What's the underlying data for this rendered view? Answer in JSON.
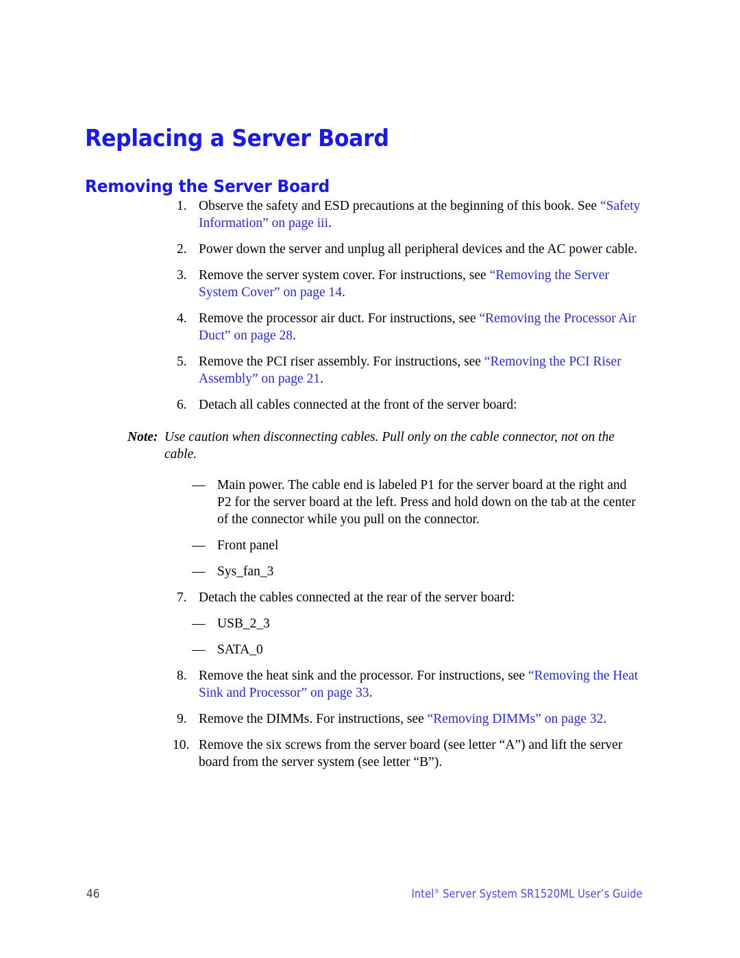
{
  "document": {
    "title": "Replacing a Server Board",
    "section_heading": "Removing the Server Board"
  },
  "colors": {
    "heading_blue": "#1a1ae6",
    "link_blue": "#2a2ac8",
    "footer_blue": "#4a4ad8",
    "body_black": "#000000",
    "page_number_gray": "#3d3d3d"
  },
  "steps": [
    {
      "number": "1.",
      "parts": [
        {
          "text": "Observe the safety and ESD precautions at the beginning of this book. See ",
          "link": false
        },
        {
          "text": "“Safety Information” on page iii",
          "link": true
        },
        {
          "text": ".",
          "link": false
        }
      ]
    },
    {
      "number": "2.",
      "parts": [
        {
          "text": "Power down the server and unplug all peripheral devices and the AC power cable.",
          "link": false
        }
      ]
    },
    {
      "number": "3.",
      "parts": [
        {
          "text": "Remove the server system cover. For instructions, see ",
          "link": false
        },
        {
          "text": "“Removing the Server System Cover” on page 14",
          "link": true
        },
        {
          "text": ".",
          "link": false
        }
      ]
    },
    {
      "number": "4.",
      "parts": [
        {
          "text": "Remove the processor air duct. For instructions, see ",
          "link": false
        },
        {
          "text": "“Removing the Processor Air Duct” on page 28",
          "link": true
        },
        {
          "text": ".",
          "link": false
        }
      ]
    },
    {
      "number": "5.",
      "parts": [
        {
          "text": "Remove the PCI riser assembly. For instructions, see ",
          "link": false
        },
        {
          "text": "“Removing the PCI Riser Assembly” on page 21",
          "link": true
        },
        {
          "text": ".",
          "link": false
        }
      ]
    },
    {
      "number": "6.",
      "parts": [
        {
          "text": "Detach all cables connected at the front of the server board:",
          "link": false
        }
      ]
    }
  ],
  "note": {
    "label": "Note:",
    "text": "Use caution when disconnecting cables. Pull only on the cable connector, not on the cable."
  },
  "front_cables": [
    {
      "marker": "—",
      "text": "Main power. The cable end is labeled P1 for the server board at the right and P2 for the server board at the left. Press and hold down on the tab at the center of the connector while you pull on the connector."
    },
    {
      "marker": "—",
      "text": "Front panel"
    },
    {
      "marker": "—",
      "text": "Sys_fan_3"
    }
  ],
  "step7": {
    "number": "7.",
    "text": "Detach the cables connected at the rear of the server board:"
  },
  "rear_cables": [
    {
      "marker": "—",
      "text": "USB_2_3"
    },
    {
      "marker": "—",
      "text": "SATA_0"
    }
  ],
  "steps_tail": [
    {
      "number": "8.",
      "parts": [
        {
          "text": "Remove the heat sink and the processor. For instructions, see ",
          "link": false
        },
        {
          "text": "“Removing the Heat Sink and Processor” on page 33",
          "link": true
        },
        {
          "text": ".",
          "link": false
        }
      ]
    },
    {
      "number": "9.",
      "parts": [
        {
          "text": "Remove the DIMMs. For instructions, see ",
          "link": false
        },
        {
          "text": "“Removing DIMMs” on page 32",
          "link": true
        },
        {
          "text": ".",
          "link": false
        }
      ]
    },
    {
      "number": "10.",
      "parts": [
        {
          "text": "Remove the six screws from the server board (see letter “A”) and lift the server board from the server system (see letter “B”).",
          "link": false
        }
      ]
    }
  ],
  "footer": {
    "page_number": "46",
    "brand": "Intel",
    "trademark": "®",
    "guide_title": " Server System SR1520ML User’s Guide"
  }
}
